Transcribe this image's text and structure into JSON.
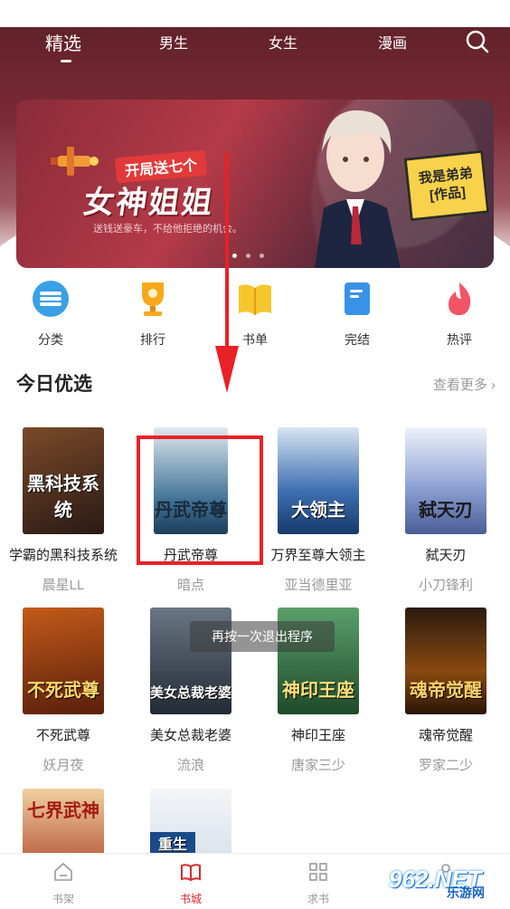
{
  "tabs": {
    "items": [
      {
        "label": "精选",
        "active": true
      },
      {
        "label": "男生",
        "active": false
      },
      {
        "label": "女生",
        "active": false
      },
      {
        "label": "漫画",
        "active": false
      }
    ]
  },
  "banner": {
    "tag": "开局送七个",
    "headline": "女神姐姐",
    "subtitle": "送钱送豪车，不给他拒绝的机会。",
    "badge_line1": "我是弟弟",
    "badge_line2": "[作品]",
    "active_dot": 0
  },
  "quick": [
    {
      "label": "分类",
      "icon": "category-icon"
    },
    {
      "label": "排行",
      "icon": "trophy-icon"
    },
    {
      "label": "书单",
      "icon": "book-list-icon"
    },
    {
      "label": "完结",
      "icon": "finished-icon"
    },
    {
      "label": "热评",
      "icon": "hot-comment-icon"
    }
  ],
  "section": {
    "title": "今日优选",
    "more": "查看更多 ›"
  },
  "books": [
    {
      "title": "学霸的黑科技系统",
      "author": "晨星LL",
      "cover_text": "黑科技系统",
      "color": "#3b2a20"
    },
    {
      "title": "丹武帝尊",
      "author": "暗点",
      "cover_text": "丹武帝尊",
      "color": "#2f5a7a"
    },
    {
      "title": "万界至尊大领主",
      "author": "亚当德里亚",
      "cover_text": "大领主",
      "color": "#1e4f8f"
    },
    {
      "title": "弑天刃",
      "author": "小刀锋利",
      "cover_text": "弑天刃",
      "color": "#5a6fa8"
    },
    {
      "title": "不死武尊",
      "author": "妖月夜",
      "cover_text": "不死武尊",
      "color": "#6a2a10"
    },
    {
      "title": "美女总裁老婆",
      "author": "流浪",
      "cover_text": "美女总裁老婆",
      "color": "#2a3440"
    },
    {
      "title": "神印王座",
      "author": "唐家三少",
      "cover_text": "神印王座",
      "color": "#2f6a3a"
    },
    {
      "title": "魂帝觉醒",
      "author": "罗家二少",
      "cover_text": "魂帝觉醒",
      "color": "#3a2010"
    },
    {
      "title": "",
      "author": "",
      "cover_text": "七界武神",
      "color": "#8a1a10"
    },
    {
      "title": "",
      "author": "",
      "cover_text": "重生",
      "color": "#c9d6e4"
    }
  ],
  "toast": "再按一次退出程序",
  "bottom_nav": [
    {
      "label": "书架",
      "active": false
    },
    {
      "label": "书城",
      "active": true
    },
    {
      "label": "求书",
      "active": false
    },
    {
      "label": "",
      "active": false
    }
  ],
  "watermark": {
    "line1": "962.NET",
    "line2": "乐游网"
  },
  "colors": {
    "accent": "#d62b2b",
    "annotation": "#e82127"
  }
}
